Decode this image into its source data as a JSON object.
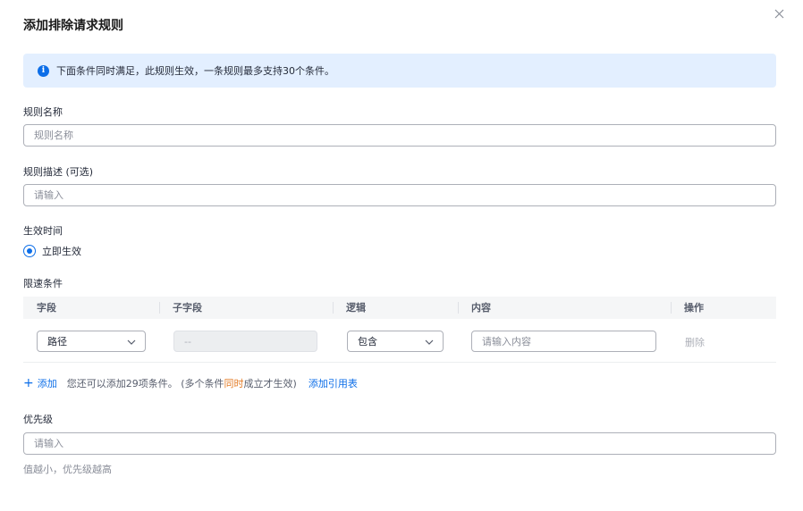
{
  "dialog": {
    "title": "添加排除请求规则",
    "close_icon": "close-icon"
  },
  "info": {
    "text": "下面条件同时满足，此规则生效，一条规则最多支持30个条件。",
    "icon": "info-icon"
  },
  "rule_name": {
    "label": "规则名称",
    "placeholder": "规则名称",
    "value": ""
  },
  "rule_desc": {
    "label": "规则描述 (可选)",
    "placeholder": "请输入",
    "value": ""
  },
  "effective_time": {
    "label": "生效时间",
    "option": "立即生效",
    "selected": true
  },
  "conditions": {
    "label": "限速条件",
    "columns": [
      "字段",
      "子字段",
      "逻辑",
      "内容",
      "操作"
    ],
    "rows": [
      {
        "field": "路径",
        "subfield": "--",
        "logic": "包含",
        "content_placeholder": "请输入内容",
        "action": "删除"
      }
    ],
    "add_label": "添加",
    "hint_before": "您还可以添加29项条件。 (多个条件",
    "hint_highlight": "同时",
    "hint_after": "成立才生效)",
    "ref_link": "添加引用表"
  },
  "priority": {
    "label": "优先级",
    "placeholder": "请输入",
    "value": "",
    "helper": "值越小，优先级越高"
  },
  "colors": {
    "primary": "#0c6ee8",
    "info_bg": "#e3efff",
    "highlight": "#e37d29"
  }
}
